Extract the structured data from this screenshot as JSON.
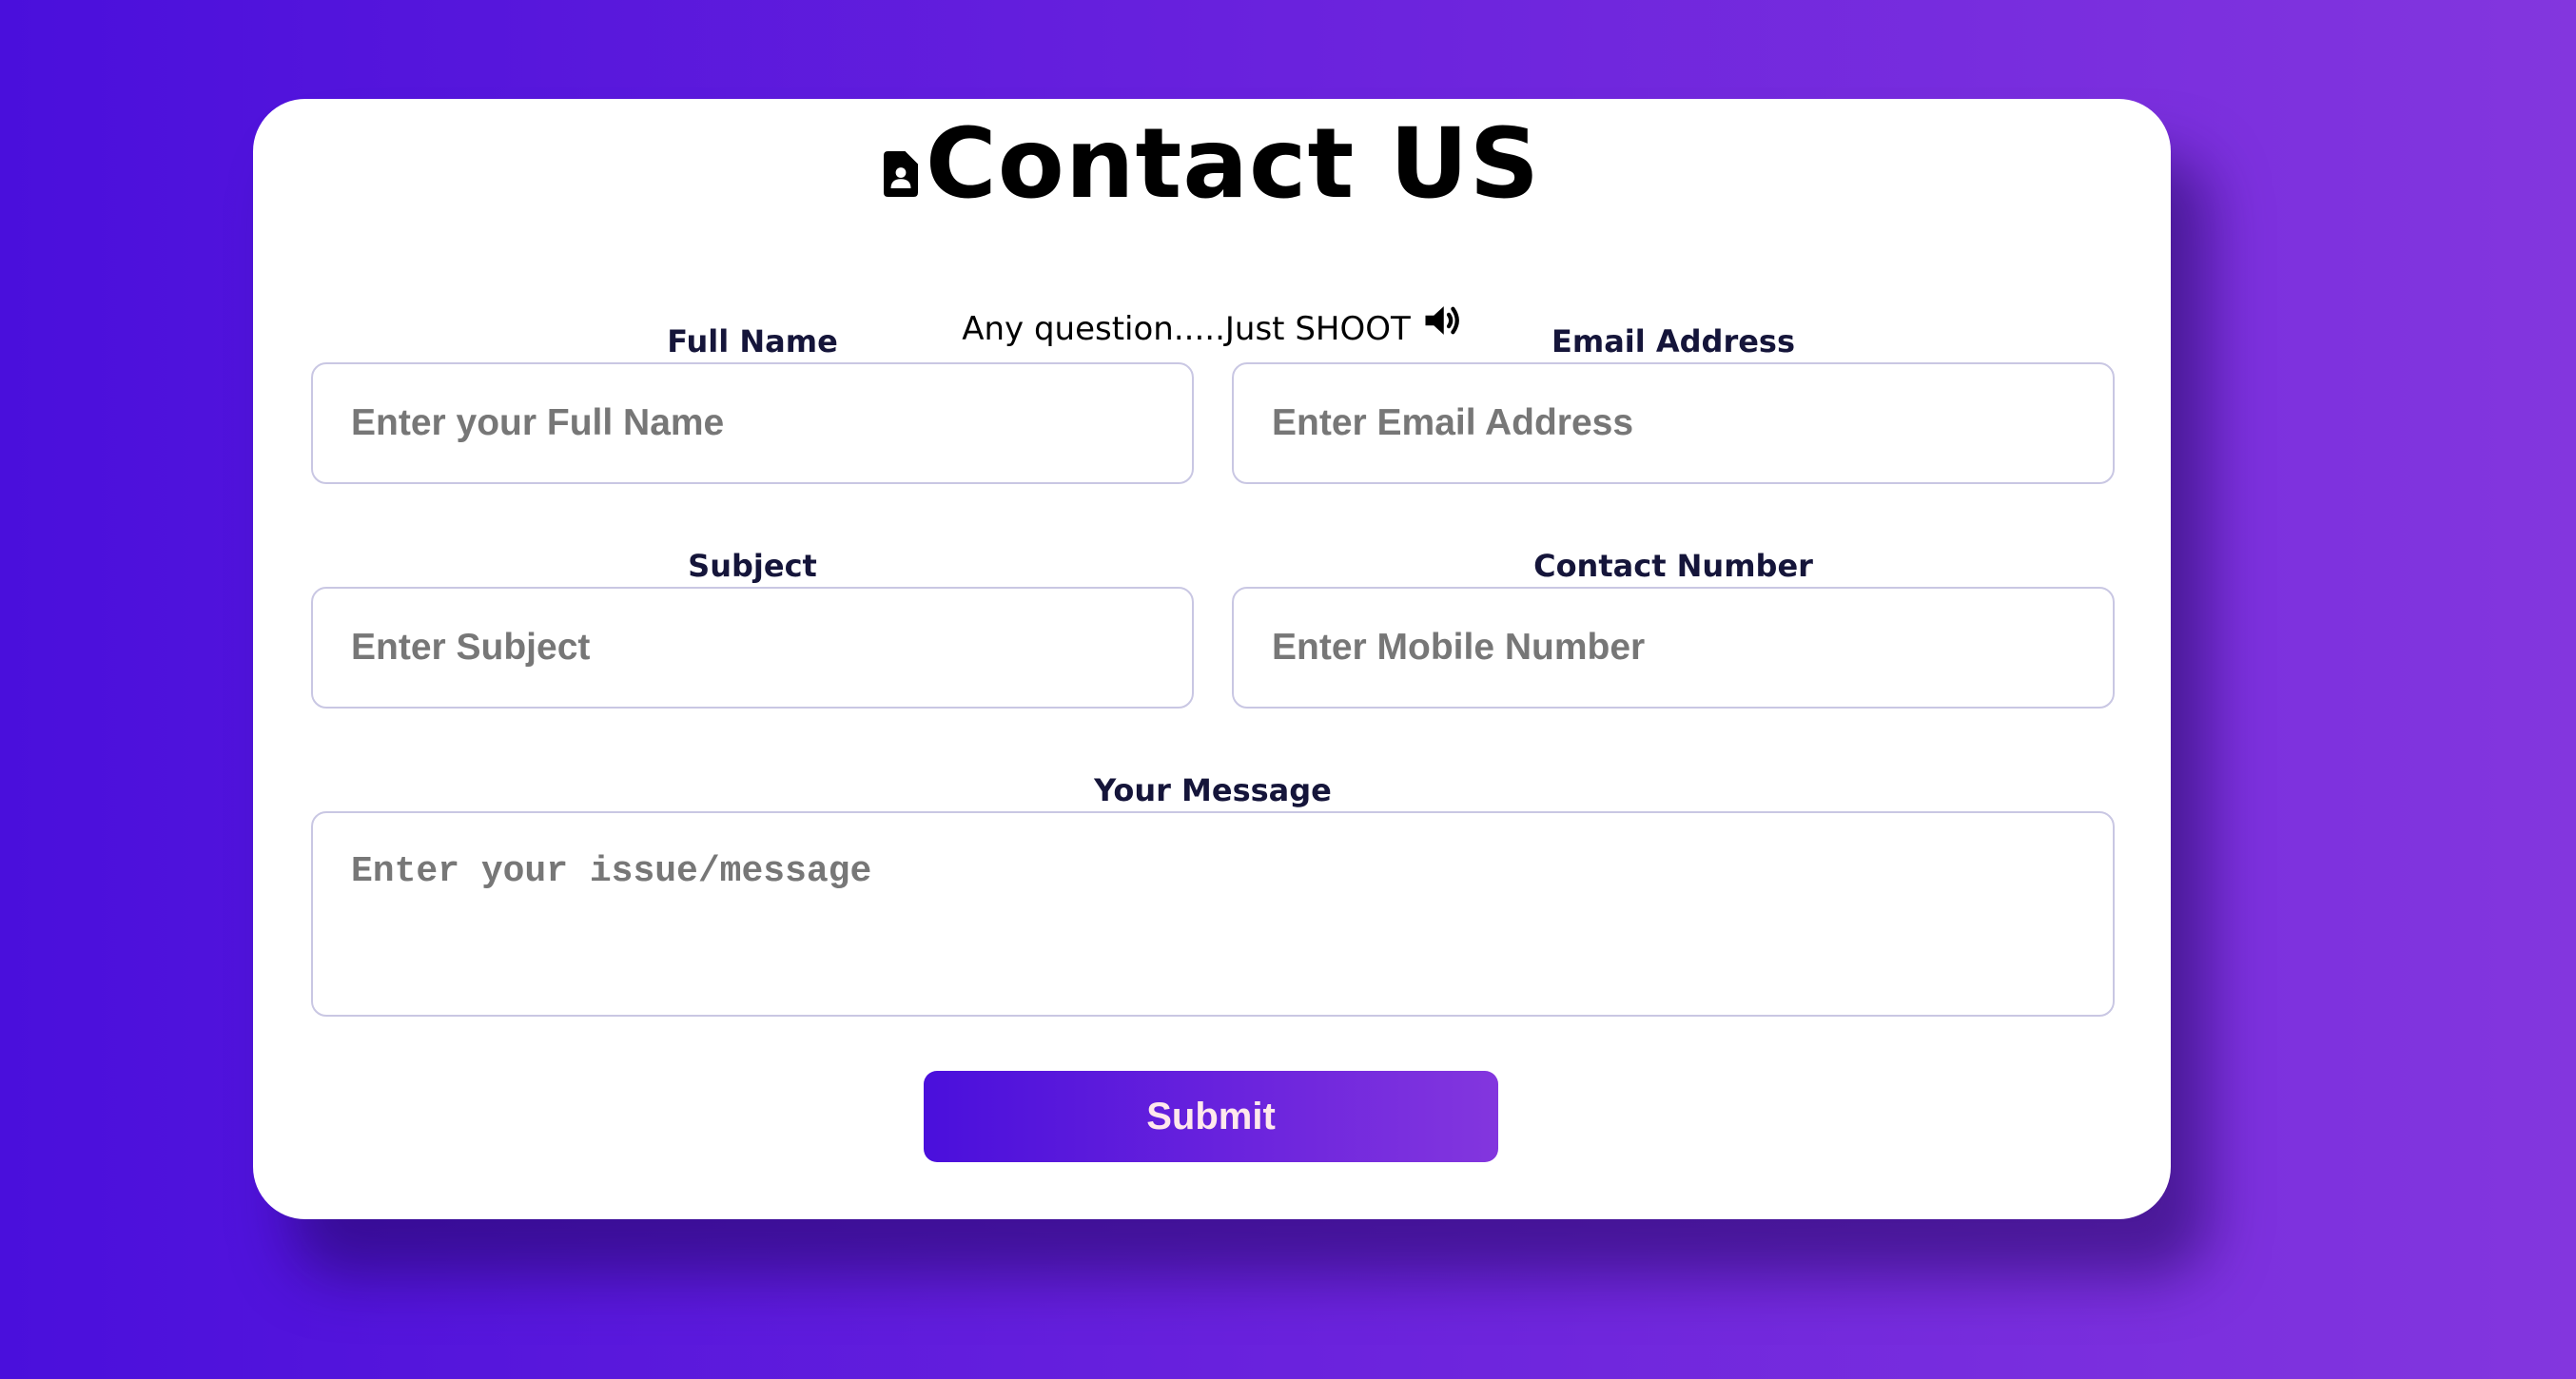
{
  "header": {
    "title": "Contact US",
    "title_icon": "contact-card-icon",
    "subtitle": "Any question.....Just SHOOT",
    "subtitle_icon": "speaker-icon"
  },
  "form": {
    "full_name": {
      "label": "Full Name",
      "placeholder": "Enter your Full Name",
      "value": ""
    },
    "email": {
      "label": "Email Address",
      "placeholder": "Enter Email Address",
      "value": ""
    },
    "subject": {
      "label": "Subject",
      "placeholder": "Enter Subject",
      "value": ""
    },
    "contact_number": {
      "label": "Contact Number",
      "placeholder": "Enter Mobile Number",
      "value": ""
    },
    "message": {
      "label": "Your Message",
      "placeholder": "Enter your issue/message",
      "value": ""
    },
    "submit_label": "Submit"
  },
  "colors": {
    "background_start": "#4a0fdc",
    "background_end": "#8336de",
    "card": "#ffffff",
    "label_text": "#15153a",
    "placeholder": "#777777",
    "submit_text": "#ffe8ec"
  }
}
